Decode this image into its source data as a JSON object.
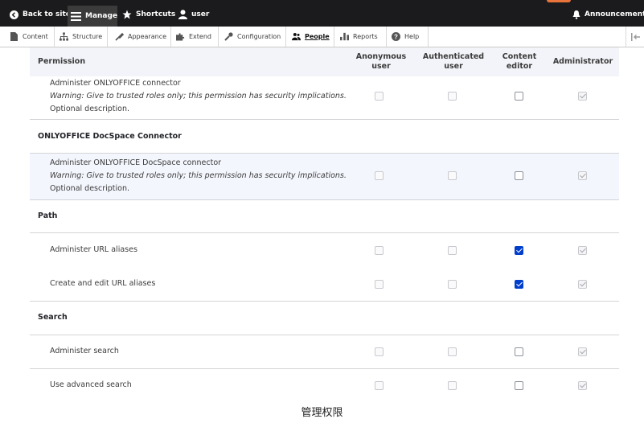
{
  "toolbar": {
    "back_label": "Back to site",
    "manage_label": "Manage",
    "shortcuts_label": "Shortcuts",
    "user_label": "user",
    "announcements_label": "Announcements"
  },
  "tray": {
    "tabs": [
      {
        "label": "Content",
        "icon": "file-icon"
      },
      {
        "label": "Structure",
        "icon": "sitemap-icon"
      },
      {
        "label": "Appearance",
        "icon": "brush-icon"
      },
      {
        "label": "Extend",
        "icon": "puzzle-icon"
      },
      {
        "label": "Configuration",
        "icon": "wrench-icon"
      },
      {
        "label": "People",
        "icon": "people-icon",
        "active": true
      },
      {
        "label": "Reports",
        "icon": "chart-icon"
      },
      {
        "label": "Help",
        "icon": "help-icon"
      }
    ]
  },
  "table": {
    "headers": {
      "permission": "Permission",
      "anonymous_1": "Anonymous",
      "anonymous_2": "user",
      "authenticated_1": "Authenticated",
      "authenticated_2": "user",
      "editor_1": "Content",
      "editor_2": "editor",
      "administrator": "Administrator"
    },
    "rows": [
      {
        "type": "perm",
        "name": "Administer ONLYOFFICE connector",
        "warning": "Warning: Give to trusted roles only; this permission has security implications.",
        "desc": "Optional description.",
        "anonymous": false,
        "authenticated": false,
        "editor": false,
        "admin": true
      },
      {
        "type": "group",
        "title": "ONLYOFFICE DocSpace Connector"
      },
      {
        "type": "perm",
        "name": "Administer ONLYOFFICE DocSpace connector",
        "warning": "Warning: Give to trusted roles only; this permission has security implications.",
        "desc": "Optional description.",
        "anonymous": false,
        "authenticated": false,
        "editor": false,
        "admin": true
      },
      {
        "type": "group",
        "title": "Path"
      },
      {
        "type": "perm",
        "name": "Administer URL aliases",
        "anonymous": false,
        "authenticated": false,
        "editor": true,
        "admin": true
      },
      {
        "type": "perm",
        "name": "Create and edit URL aliases",
        "anonymous": false,
        "authenticated": false,
        "editor": true,
        "admin": true
      },
      {
        "type": "group",
        "title": "Search"
      },
      {
        "type": "perm",
        "name": "Administer search",
        "anonymous": false,
        "authenticated": false,
        "editor": false,
        "admin": true
      },
      {
        "type": "perm",
        "name": "Use advanced search",
        "anonymous": false,
        "authenticated": false,
        "editor": false,
        "admin": true
      }
    ]
  },
  "caption": "管理权限",
  "colors": {
    "toolbar": "#1b1b1d",
    "accent": "#003ecc",
    "header_bg": "#f3f4f9",
    "highlight_row": "#f3f6fd"
  }
}
